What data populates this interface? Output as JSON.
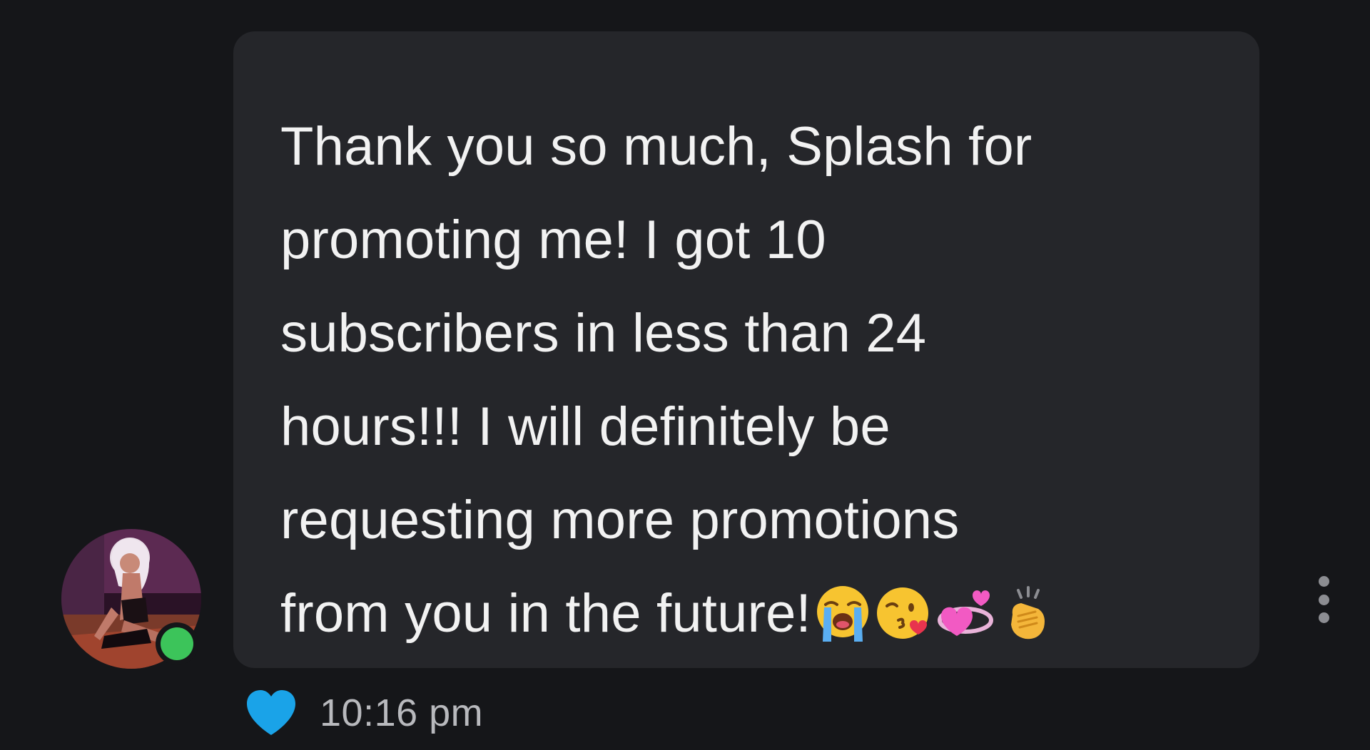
{
  "message": {
    "text": "Thank you so much, Splash for\npromoting me! I got 10\nsubscribers in less than 24\nhours!!! I will definitely be\nrequesting more promotions\nfrom you in the future!",
    "emojis": [
      "loudly-crying-face",
      "face-blowing-a-kiss",
      "revolving-hearts",
      "clapping-hands"
    ],
    "timestamp": "10:16 pm",
    "liked": true
  },
  "sender": {
    "avatar": "profile-photo",
    "online": true
  },
  "colors": {
    "background": "#151619",
    "bubble": "#25262a",
    "text": "#f2f2f2",
    "heart": "#1aa3e8",
    "online": "#3cc45a",
    "timestamp": "#b8b9bd"
  },
  "icons": {
    "like": "heart-icon",
    "more": "more-vertical-icon"
  }
}
